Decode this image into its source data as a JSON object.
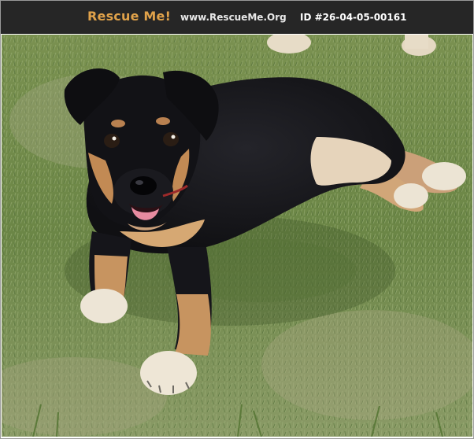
{
  "header": {
    "brand": "Rescue Me!",
    "site": "www.RescueMe.Org",
    "pet_id": "ID #26-04-05-00161"
  },
  "photo": {
    "subject": "black-and-tan puppy lying on grass",
    "colors": {
      "header_bg": "#262626",
      "brand": "#e0a24a",
      "grass": "#6f8a4a",
      "fur_black": "#141418",
      "fur_tan": "#c9955e"
    }
  }
}
